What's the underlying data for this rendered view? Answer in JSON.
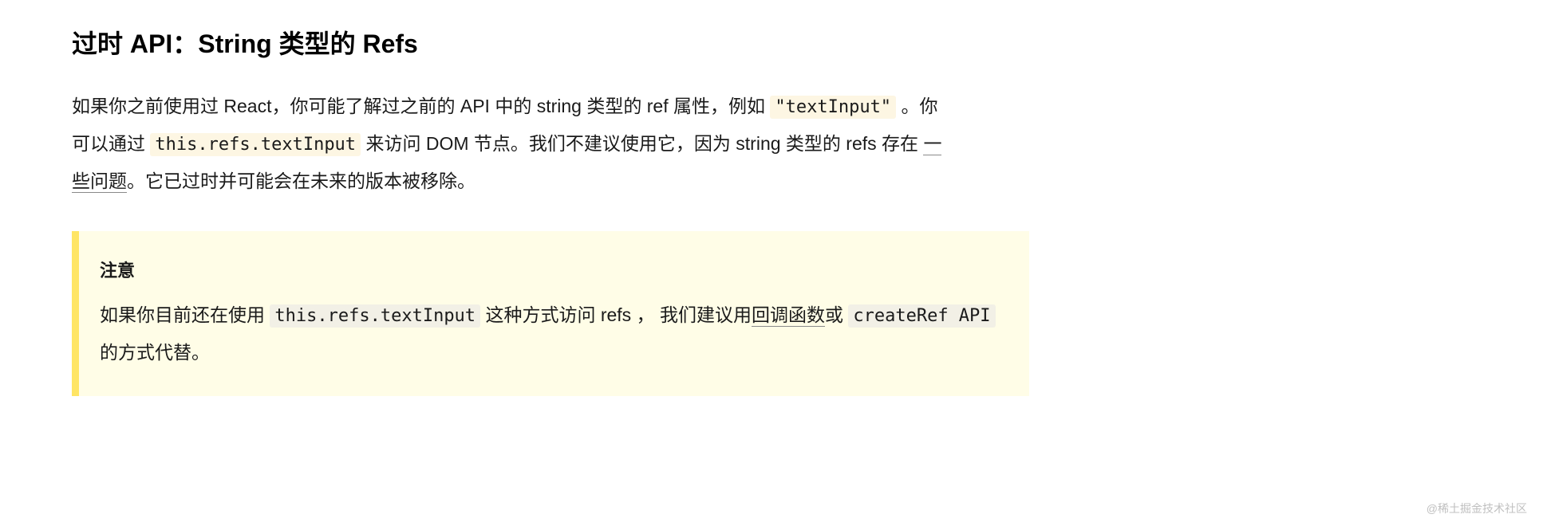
{
  "heading": "过时 API：String 类型的 Refs",
  "para": {
    "t1": "如果你之前使用过 React，你可能了解过之前的 API 中的 string 类型的 ref 属性，例如 ",
    "code1": "\"textInput\"",
    "t2": " 。你可以通过 ",
    "code2": "this.refs.textInput",
    "t3": " 来访问 DOM 节点。我们不建议使用它，因为 string 类型的 refs 存在 ",
    "link1": "一些问题",
    "t4": "。它已过时并可能会在未来的版本被移除。"
  },
  "callout": {
    "title": "注意",
    "body": {
      "t1": "如果你目前还在使用 ",
      "code1": "this.refs.textInput",
      "t2": " 这种方式访问 refs ， 我们建议用",
      "link1": "回调函数",
      "t3": "或 ",
      "code2": "createRef API",
      "t4": " 的方式代替。"
    }
  },
  "watermark": "@稀土掘金技术社区"
}
